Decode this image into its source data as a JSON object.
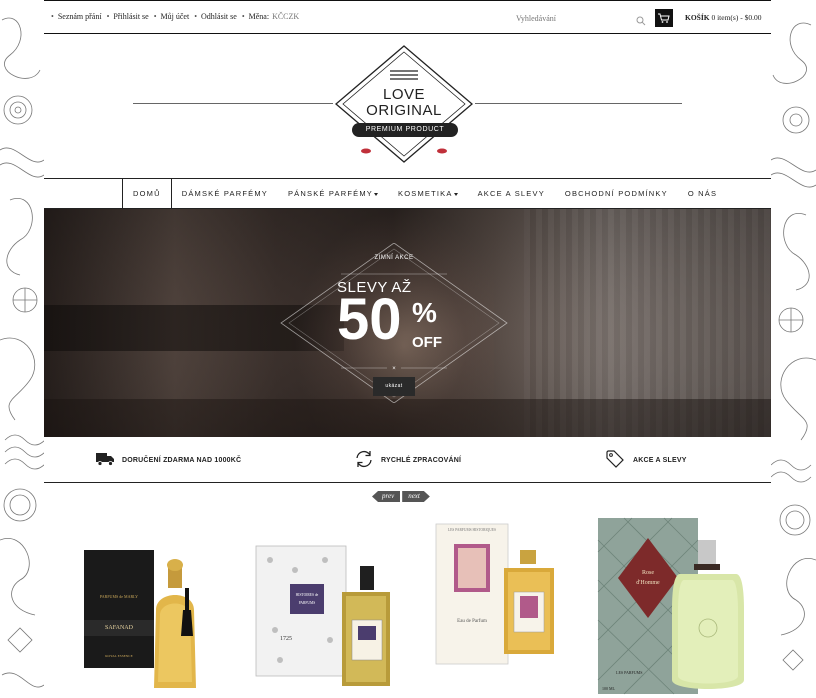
{
  "topbar": {
    "links": [
      "Seznám přání",
      "Přihlásit se",
      "Můj účet",
      "Odhlásit se"
    ],
    "currency_label": "Měna:",
    "currency_value": "KČCZK",
    "search_placeholder": "Vyhledávání",
    "cart_label": "KOŠÍK",
    "cart_summary": "0 item(s) - $0.00"
  },
  "logo": {
    "line1": "LOVE",
    "line2": "ORIGINAL",
    "tagline": "PREMIUM PRODUCT"
  },
  "nav": {
    "items": [
      {
        "label": "DOMŮ",
        "active": true,
        "dropdown": false
      },
      {
        "label": "DÁMSKÉ PARFÉMY",
        "active": false,
        "dropdown": false
      },
      {
        "label": "PÁNSKÉ PARFÉMY",
        "active": false,
        "dropdown": true
      },
      {
        "label": "KOSMETIKA",
        "active": false,
        "dropdown": true
      },
      {
        "label": "AKCE A SLEVY",
        "active": false,
        "dropdown": false
      },
      {
        "label": "OBCHODNÍ PODMÍNKY",
        "active": false,
        "dropdown": false
      },
      {
        "label": "O NÁS",
        "active": false,
        "dropdown": false
      }
    ]
  },
  "hero": {
    "subtitle": "ZIMNÍ AKCE",
    "headline": "SLEVY AŽ",
    "number": "50",
    "percent": "%",
    "off": "OFF",
    "button": "ukázat"
  },
  "features": [
    {
      "icon": "truck-icon",
      "label": "DORUČENÍ ZDARMA NAD 1000KČ"
    },
    {
      "icon": "refresh-icon",
      "label": "RYCHLÉ ZPRACOVÁNÍ"
    },
    {
      "icon": "tag-icon",
      "label": "AKCE A SLEVY"
    }
  ],
  "pager": {
    "prev": "prev",
    "next": "next"
  },
  "products": [
    {
      "name": "SAFANAD",
      "brand": "PARFUMS de MARLY",
      "line": "ROYAL ESSENCE"
    },
    {
      "name": "HISTOIRES de PARFUMS",
      "brand": "1725"
    },
    {
      "name": "LES PARFUMS HISTORIQUES",
      "brand": "Eau de Parfum"
    },
    {
      "name": "Rose d'Homme",
      "brand": "LES PARFUMS",
      "size": "100 ML"
    }
  ],
  "colors": {
    "accent": "#111111",
    "text": "#222222",
    "hero_overlay": "#2a2a2a"
  }
}
